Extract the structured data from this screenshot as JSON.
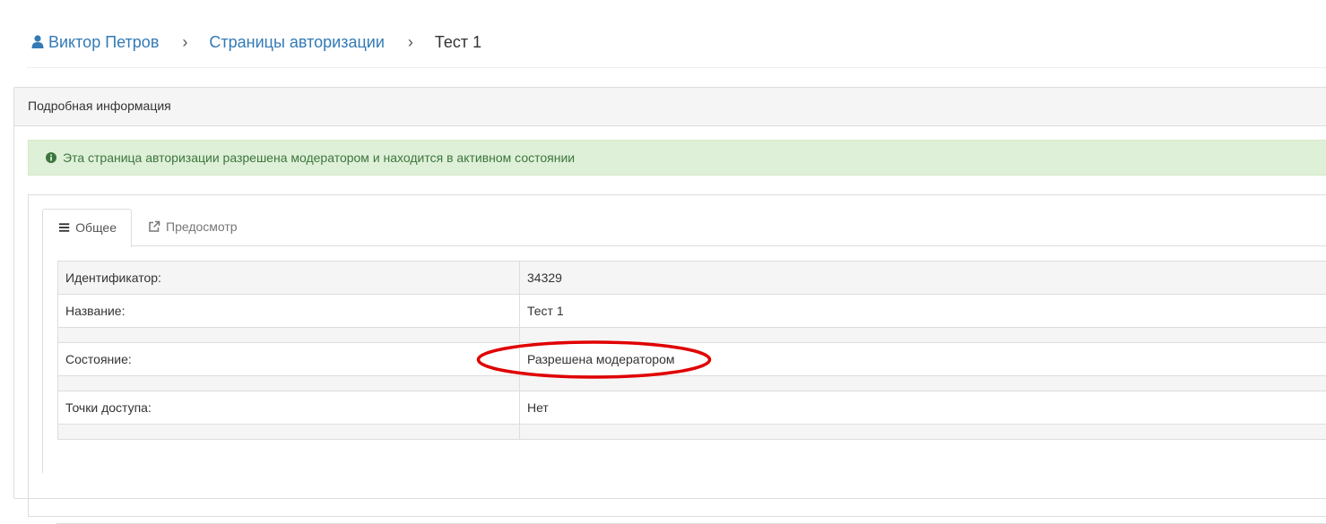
{
  "breadcrumb": {
    "user_name": "Виктор Петров",
    "section": "Страницы авторизации",
    "current": "Тест 1",
    "separator": "›"
  },
  "panel": {
    "heading": "Подробная информация",
    "alert": "Эта страница авторизации разрешена модератором и находится в активном состоянии"
  },
  "tabs": [
    {
      "label": "Общее",
      "icon": "list-icon",
      "active": true
    },
    {
      "label": "Предосмотр",
      "icon": "external-link-icon",
      "active": false
    }
  ],
  "details": {
    "id_label": "Идентификатор:",
    "id_value": "34329",
    "name_label": "Название:",
    "name_value": "Тест 1",
    "state_label": "Состояние:",
    "state_value": "Разрешена модератором",
    "access_label": "Точки доступа:",
    "access_value": "Нет"
  },
  "colors": {
    "link": "#337ab7",
    "alert_bg": "#dff0d8",
    "alert_text": "#3c763d",
    "highlight": "#e00000"
  }
}
